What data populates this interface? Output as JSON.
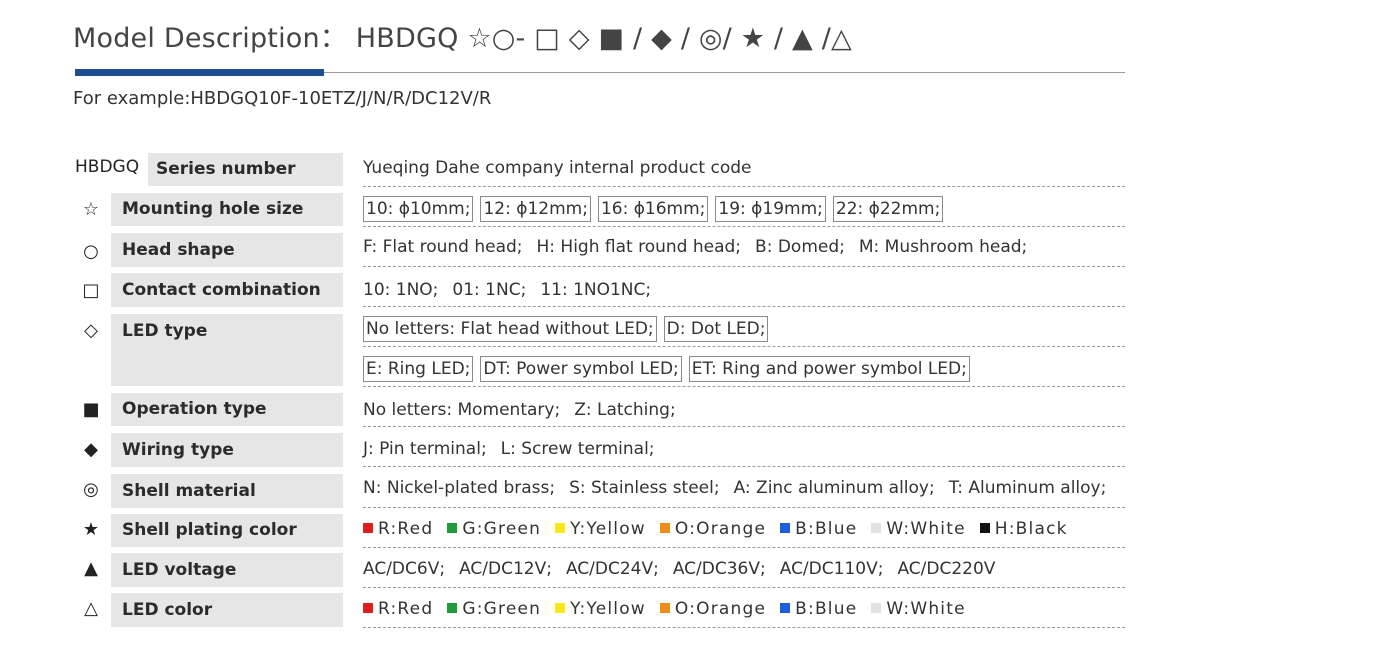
{
  "header": {
    "title": "Model Description： HBDGQ ☆○- □ ◇ ■ / ◆ / ◎/ ★ / ▲ /△",
    "example": "For example:HBDGQ10F-10ETZ/J/N/R/DC12V/R"
  },
  "colors": {
    "accent": "#1d4e8f",
    "label_bg": "#e6e6e6"
  },
  "rows": [
    {
      "symbol": "HBDGQ",
      "label": "Series number",
      "values": [
        "Yueqing Dahe company internal product code"
      ]
    },
    {
      "symbol": "☆",
      "symbol_name": "white-star-icon",
      "label": "Mounting hole size",
      "values": [
        "10: ϕ10mm;",
        "12: ϕ12mm;",
        "16: ϕ16mm;",
        "19: ϕ19mm;",
        "22: ϕ22mm;"
      ]
    },
    {
      "symbol": "○",
      "symbol_name": "white-circle-icon",
      "label": "Head  shape",
      "values": [
        "F: Flat round head;",
        "H: High flat round head;",
        "B: Domed;",
        "M: Mushroom head;"
      ]
    },
    {
      "symbol": "□",
      "symbol_name": "white-square-icon",
      "label": "Contact combination",
      "values": [
        "10: 1NO;",
        "01: 1NC;",
        "11: 1NO1NC;"
      ]
    },
    {
      "symbol": "◇",
      "symbol_name": "white-diamond-icon",
      "label": "LED type",
      "values": [
        "No letters: Flat head without LED;",
        "D: Dot LED;"
      ],
      "values_2": [
        "E: Ring LED;",
        "DT: Power symbol LED;",
        "ET: Ring and power symbol LED;"
      ]
    },
    {
      "symbol": "■",
      "symbol_name": "black-square-icon",
      "label": "Operation type",
      "values": [
        "No letters: Momentary;",
        "Z: Latching;"
      ]
    },
    {
      "symbol": "◆",
      "symbol_name": "black-diamond-icon",
      "label": "Wiring type",
      "values": [
        "J: Pin terminal;",
        "L: Screw terminal;"
      ]
    },
    {
      "symbol": "◎",
      "symbol_name": "bullseye-icon",
      "label": "Shell material",
      "values": [
        "N: Nickel-plated brass;",
        "S: Stainless steel;",
        "A: Zinc aluminum alloy;",
        "T: Aluminum alloy;"
      ]
    },
    {
      "symbol": "★",
      "symbol_name": "black-star-icon",
      "label": "Shell plating color",
      "colors": [
        {
          "text": "R:Red",
          "hex": "#e01e1e"
        },
        {
          "text": "G:Green",
          "hex": "#1e9a3a"
        },
        {
          "text": "Y:Yellow",
          "hex": "#f2ea1a"
        },
        {
          "text": "O:Orange",
          "hex": "#f08c1a"
        },
        {
          "text": "B:Blue",
          "hex": "#1e5fe0"
        },
        {
          "text": "W:White",
          "hex": "#e2e2e2"
        },
        {
          "text": "H:Black",
          "hex": "#111111"
        }
      ]
    },
    {
      "symbol": "▲",
      "symbol_name": "black-triangle-icon",
      "label": "LED voltage",
      "values": [
        "AC/DC6V;",
        "AC/DC12V;",
        "AC/DC24V;",
        "AC/DC36V;",
        "AC/DC110V;",
        "AC/DC220V"
      ]
    },
    {
      "symbol": "△",
      "symbol_name": "white-triangle-icon",
      "label": "LED color",
      "colors": [
        {
          "text": "R:Red",
          "hex": "#e01e1e"
        },
        {
          "text": "G:Green",
          "hex": "#1e9a3a"
        },
        {
          "text": "Y:Yellow",
          "hex": "#f2ea1a"
        },
        {
          "text": "O:Orange",
          "hex": "#f08c1a"
        },
        {
          "text": "B:Blue",
          "hex": "#1e5fe0"
        },
        {
          "text": "W:White",
          "hex": "#e2e2e2"
        }
      ]
    }
  ]
}
